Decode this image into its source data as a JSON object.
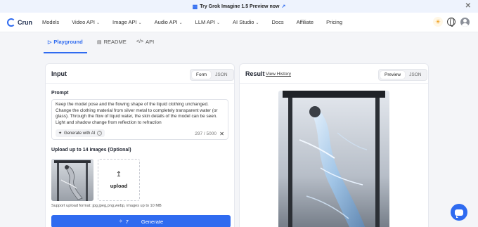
{
  "banner": {
    "text": "Try Grok Imagine 1.5 Preview now",
    "icon": "gift-icon"
  },
  "brand": {
    "name": "Crun"
  },
  "nav": {
    "items": [
      {
        "label": "Models",
        "dropdown": false
      },
      {
        "label": "Video API",
        "dropdown": true
      },
      {
        "label": "Image API",
        "dropdown": true
      },
      {
        "label": "Audio API",
        "dropdown": true
      },
      {
        "label": "LLM API",
        "dropdown": true
      },
      {
        "label": "AI Studio",
        "dropdown": true
      },
      {
        "label": "Docs",
        "dropdown": false
      },
      {
        "label": "Affiliate",
        "dropdown": false
      },
      {
        "label": "Pricing",
        "dropdown": false
      }
    ]
  },
  "tabs": {
    "playground": "Playground",
    "readme": "README",
    "api": "API"
  },
  "input_panel": {
    "title": "Input",
    "seg_form": "Form",
    "seg_json": "JSON",
    "prompt_label": "Prompt",
    "prompt_text": "Keep the model pose and the flowing shape of the liquid clothing unchanged. Change the clothing material from silver metal to completely transparent water (or glass). Through the flow of liquid water, the skin details of the model can be seen. Light and shadow change from reflection to refraction",
    "generate_ai": "Generate with AI",
    "help": "?",
    "counter": "297 / 5000",
    "upload_label": "Upload up to 14 images (Optional)",
    "upload_text": "upload",
    "support_text": "Support upload format: jpg,jpeg,png,webp, images up to 10 MB",
    "cost": "7",
    "generate_label": "Generate"
  },
  "result_panel": {
    "title": "Result",
    "view_history": "View History",
    "seg_preview": "Preview",
    "seg_json": "JSON"
  },
  "colors": {
    "accent": "#2f6bf0"
  }
}
